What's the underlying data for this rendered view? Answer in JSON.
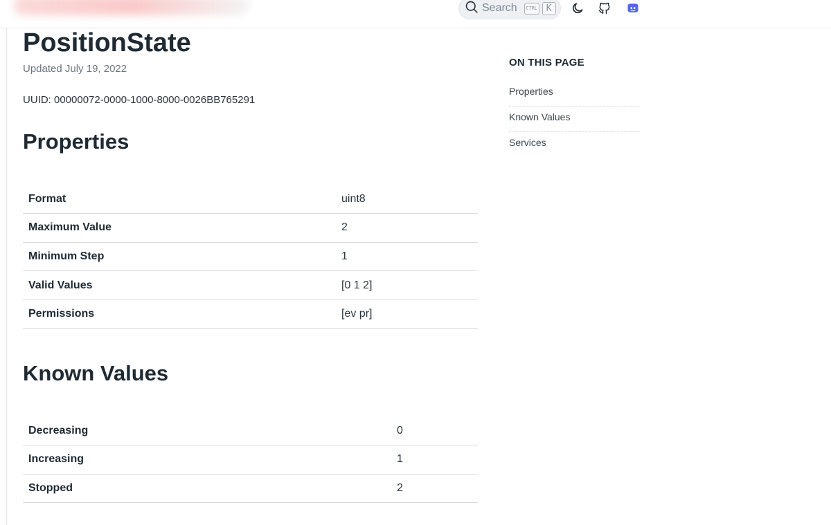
{
  "header": {
    "search_label": "Search",
    "shortcut_ctrl": "CTRL",
    "shortcut_key": "K",
    "icons": [
      "search-icon",
      "moon-icon",
      "github-icon",
      "discord-icon"
    ],
    "accent_color": "#5865F2"
  },
  "page": {
    "title": "PositionState",
    "updated": "Updated July 19, 2022",
    "uuid": "UUID: 00000072-0000-1000-8000-0026BB765291"
  },
  "properties": {
    "heading": "Properties",
    "rows": [
      {
        "key": "Format",
        "value": "uint8"
      },
      {
        "key": "Maximum Value",
        "value": "2"
      },
      {
        "key": "Minimum Step",
        "value": "1"
      },
      {
        "key": "Valid Values",
        "value": "[0 1 2]"
      },
      {
        "key": "Permissions",
        "value": "[ev pr]"
      }
    ]
  },
  "known_values": {
    "heading": "Known Values",
    "rows": [
      {
        "key": "Decreasing",
        "value": "0"
      },
      {
        "key": "Increasing",
        "value": "1"
      },
      {
        "key": "Stopped",
        "value": "2"
      }
    ]
  },
  "toc": {
    "title": "ON THIS PAGE",
    "items": [
      "Properties",
      "Known Values",
      "Services"
    ]
  }
}
